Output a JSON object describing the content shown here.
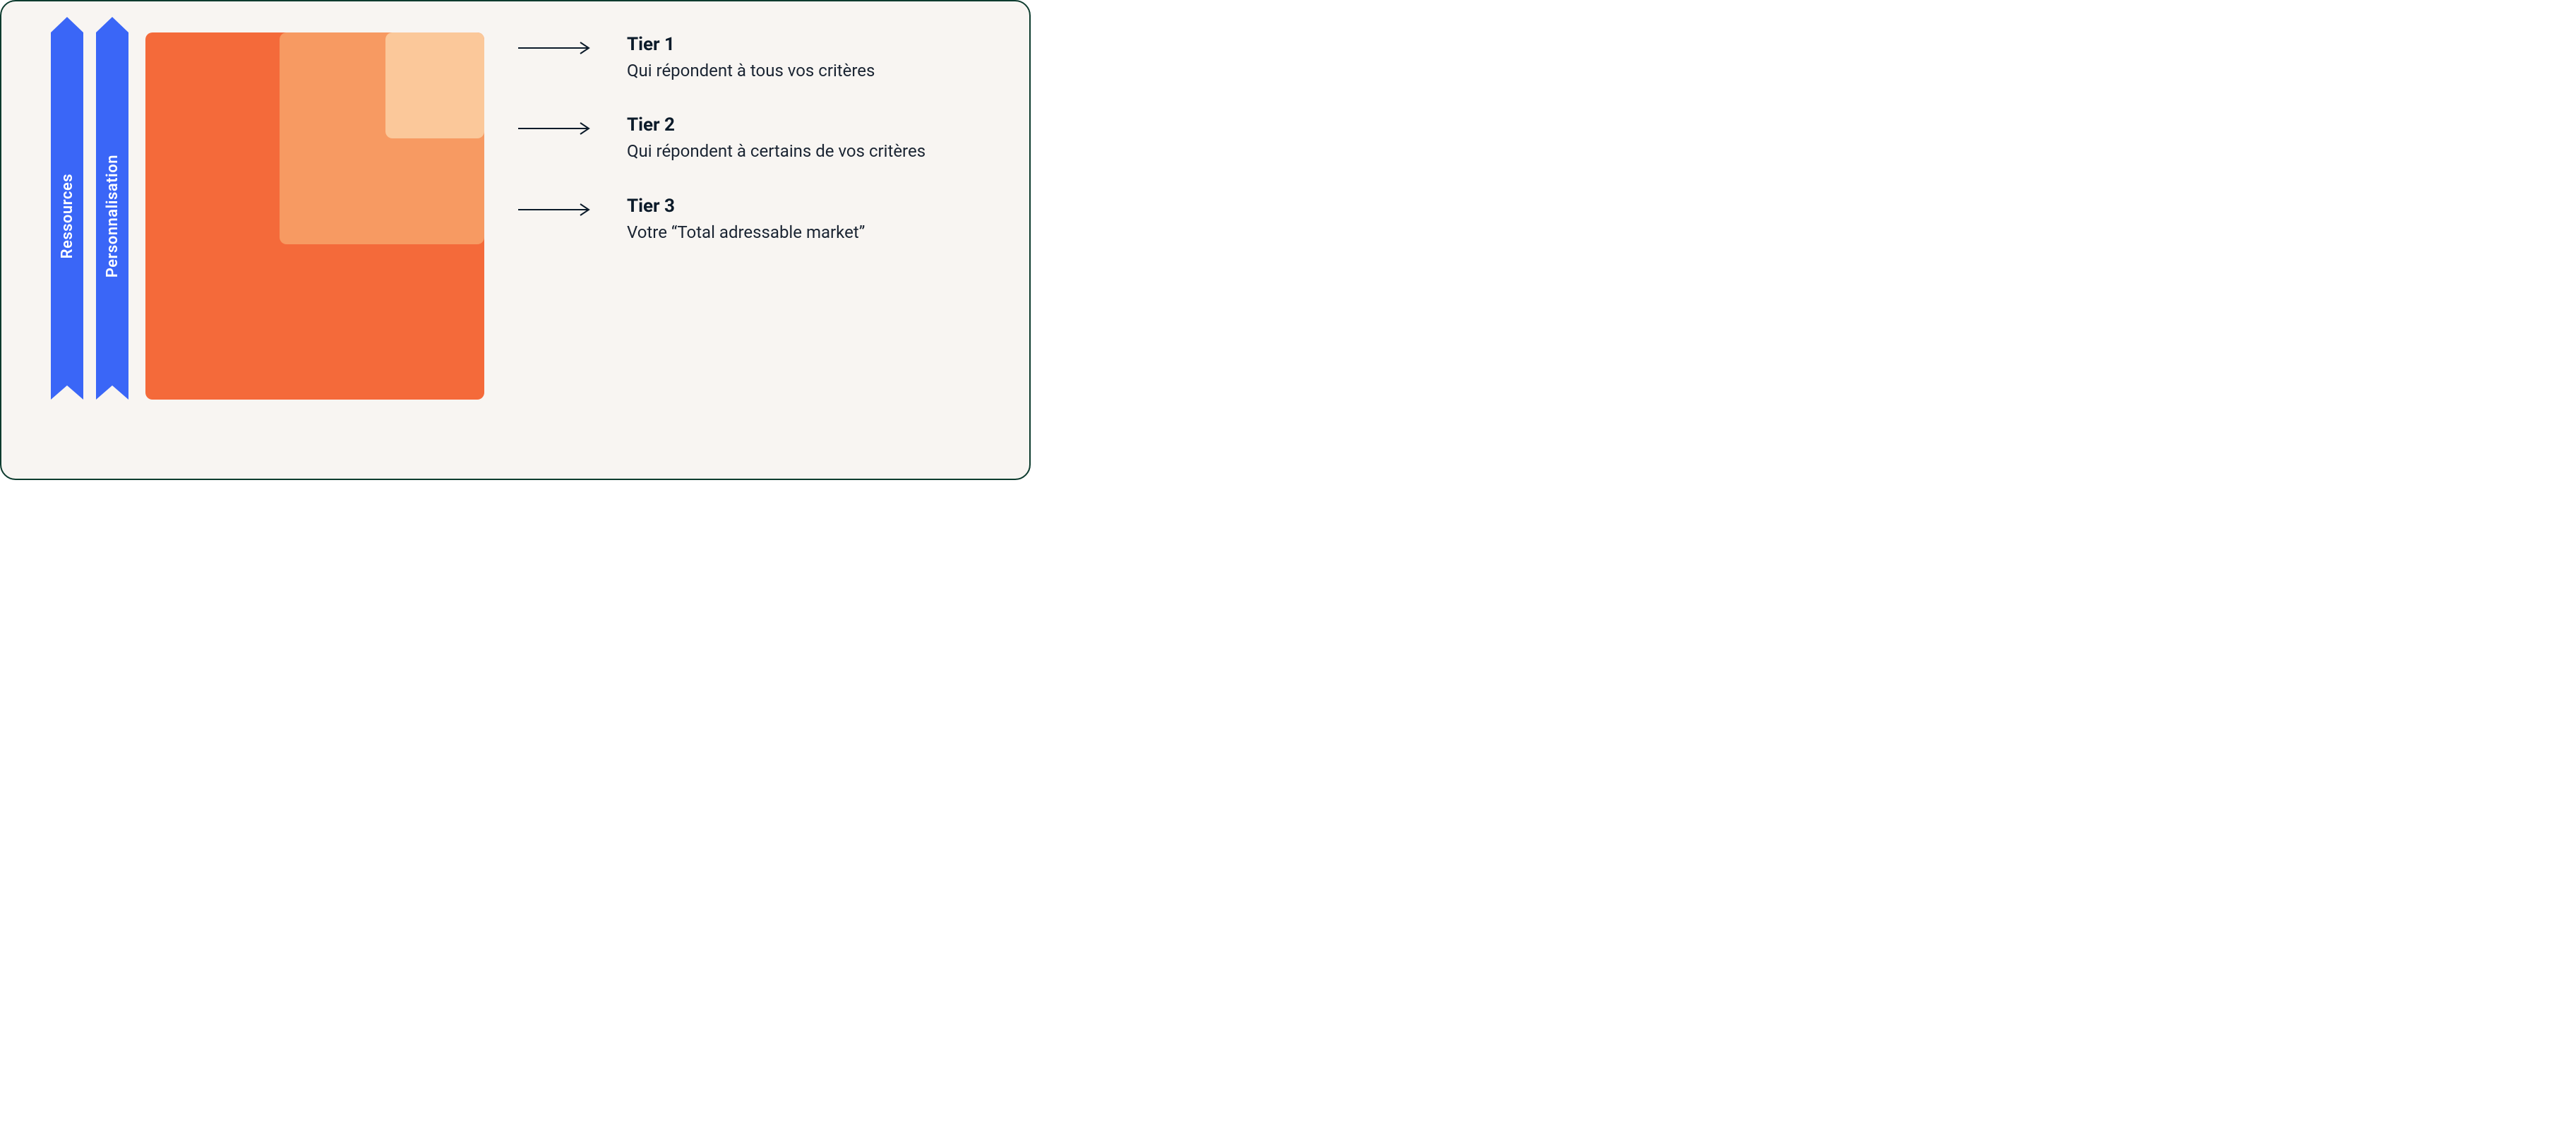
{
  "pillars": {
    "left_label": "Ressources",
    "right_label": "Personnalisation"
  },
  "tiers": [
    {
      "title": "Tier 1",
      "desc": "Qui répondent à tous vos critères"
    },
    {
      "title": "Tier 2",
      "desc": "Qui répondent à certains de vos critères"
    },
    {
      "title": "Tier 3",
      "desc": "Votre “Total adressable market”"
    }
  ],
  "colors": {
    "pillar": "#3a66f7",
    "sq_outer": "#f46a3a",
    "sq_mid": "#f79a62",
    "sq_inner": "#fbc89a",
    "card_bg": "#f8f5f2",
    "card_border": "#0d3b2e"
  }
}
